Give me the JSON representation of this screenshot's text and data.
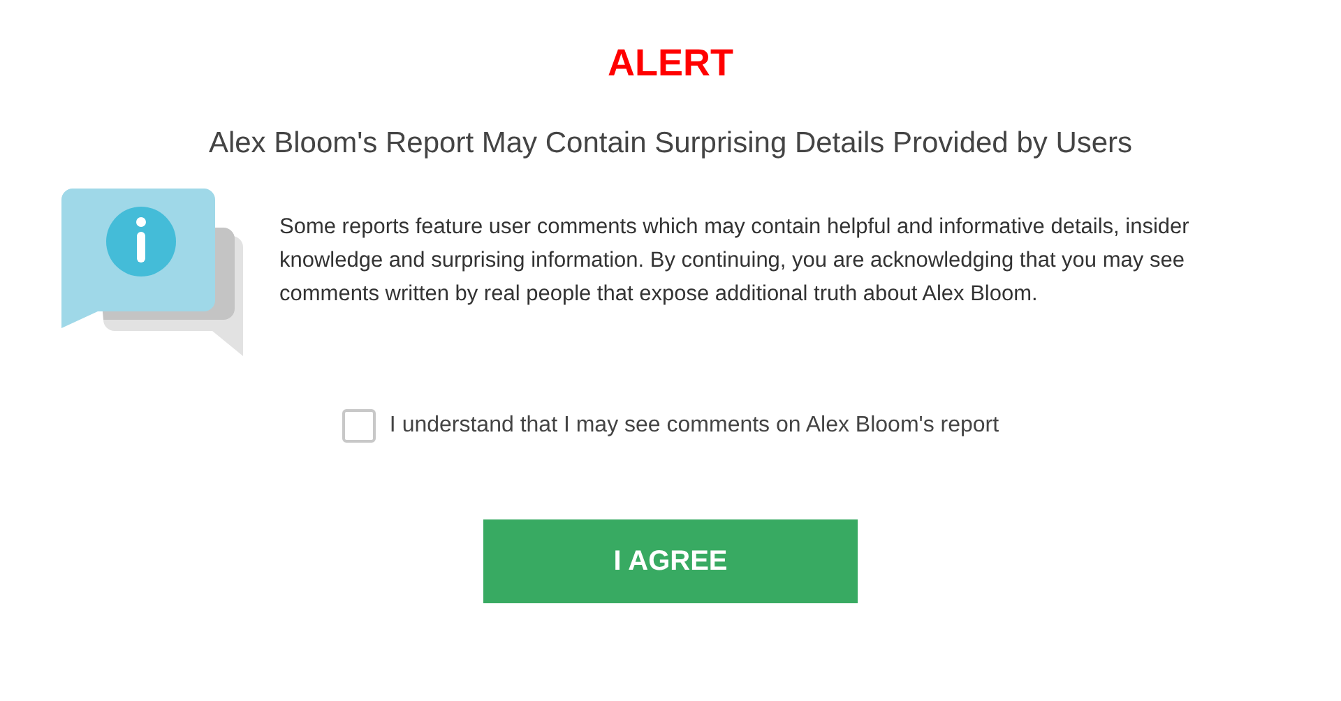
{
  "title": "ALERT",
  "subtitle": "Alex Bloom's Report May Contain Surprising Details Provided by Users",
  "message": "Some reports feature user comments which may contain helpful and informative details, insider knowledge and surprising information. By continuing, you are acknowledging that you may see comments written by real people that expose additional truth about Alex Bloom.",
  "consent": {
    "label": "I understand that I may see comments on Alex Bloom's report",
    "checked": false
  },
  "button": "I AGREE"
}
